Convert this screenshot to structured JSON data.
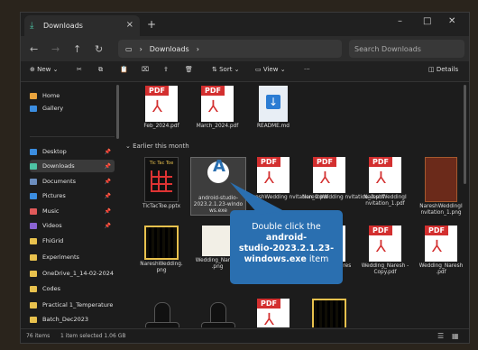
{
  "window": {
    "tab_title": "Downloads",
    "tab_close": "×",
    "new_tab": "+",
    "minimize": "–",
    "maximize": "□",
    "close": "✕"
  },
  "address": {
    "breadcrumb": "Downloads",
    "search_placeholder": "Search Downloads"
  },
  "toolbar": {
    "new_label": "New",
    "sort_label": "Sort",
    "view_label": "View",
    "more_label": "···",
    "details_label": "Details"
  },
  "sidebar": {
    "items": [
      {
        "label": "Home",
        "color": "#e8a33d"
      },
      {
        "label": "Gallery",
        "color": "#3b8de0"
      },
      {
        "label": "Desktop",
        "color": "#3b8de0"
      },
      {
        "label": "Downloads",
        "color": "#4dc3a4"
      },
      {
        "label": "Documents",
        "color": "#6c8ebf"
      },
      {
        "label": "Pictures",
        "color": "#3b8de0"
      },
      {
        "label": "Music",
        "color": "#e05a5a"
      },
      {
        "label": "Videos",
        "color": "#8a63d2"
      },
      {
        "label": "FhiGrid",
        "color": "#e8c14d"
      },
      {
        "label": "Experiments",
        "color": "#e8c14d"
      },
      {
        "label": "OneDrive_1_14-02-2024",
        "color": "#e8c14d"
      },
      {
        "label": "Codes",
        "color": "#e8c14d"
      },
      {
        "label": "Practical 1_Temperature Co",
        "color": "#e8c14d"
      },
      {
        "label": "Batch_Dec2023",
        "color": "#e8c14d"
      }
    ]
  },
  "content": {
    "group_header": "Earlier this month",
    "top_items": [
      {
        "name": "Feb_2024.pdf",
        "kind": "pdf"
      },
      {
        "name": "March_2024.pdf",
        "kind": "pdf"
      },
      {
        "name": "README.md",
        "kind": "md"
      }
    ],
    "row1": [
      {
        "name": "TicTacToe.pptx",
        "kind": "ppt",
        "thumb_text": "Tic Tac Toe"
      },
      {
        "name": "android-studio-2023.2.1.23-windo ws.exe",
        "kind": "exe",
        "selected": true
      },
      {
        "name": "NareshWedding nvitation_1.pdf",
        "kind": "pdf"
      },
      {
        "name": "NareshWedding nvitation_2.pdf",
        "kind": "pdf"
      },
      {
        "name": "NareshWeddingI nvitation_1.pdf",
        "kind": "pdf"
      },
      {
        "name": "NareshWeddingI nvitation_1.png",
        "kind": "img"
      }
    ],
    "row2": [
      {
        "name": "NareshWedding. png",
        "kind": "qr"
      },
      {
        "name": "Wedding_Naresh .png",
        "kind": "doc"
      },
      {
        "name": "Reception_Nares h.png",
        "kind": "pdf"
      },
      {
        "name": "Reception_Nares h.pdf",
        "kind": "pdf"
      },
      {
        "name": "Wedding_Naresh - Copy.pdf",
        "kind": "pdf"
      },
      {
        "name": "Wedding_Naresh .pdf",
        "kind": "pdf"
      }
    ],
    "row3": [
      {
        "kind": "shiva"
      },
      {
        "kind": "shiva"
      },
      {
        "kind": "pdf"
      },
      {
        "kind": "qr"
      }
    ],
    "pdf_label": "PDF"
  },
  "callout": {
    "line1": "Double click the",
    "line2": "android-",
    "line3": "studio-2023.2.1.23-",
    "line4": "windows.exe",
    "line4_suffix": " item"
  },
  "status": {
    "items_count": "76 items",
    "selection": "1 item selected  1.06 GB"
  }
}
